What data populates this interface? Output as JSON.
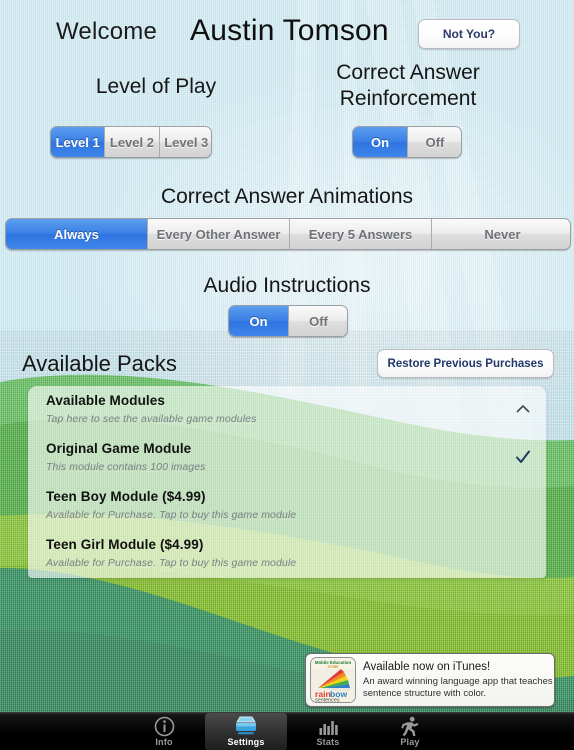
{
  "header": {
    "welcome_label": "Welcome",
    "user_name": "Austin Tomson",
    "not_you_label": "Not You?"
  },
  "sections": {
    "level_of_play": {
      "label": "Level of Play",
      "options": [
        "Level 1",
        "Level 2",
        "Level 3"
      ],
      "selected": "Level 1"
    },
    "correct_answer_reinforcement": {
      "label_line1": "Correct Answer",
      "label_line2": "Reinforcement",
      "options": [
        "On",
        "Off"
      ],
      "selected": "On"
    },
    "correct_answer_animations": {
      "label": "Correct Answer Animations",
      "options": [
        "Always",
        "Every Other Answer",
        "Every 5 Answers",
        "Never"
      ],
      "selected": "Always"
    },
    "audio_instructions": {
      "label": "Audio Instructions",
      "options": [
        "On",
        "Off"
      ],
      "selected": "On"
    }
  },
  "packs": {
    "title": "Available Packs",
    "restore_label": "Restore Previous Purchases",
    "rows": [
      {
        "title": "Available Modules",
        "subtitle": "Tap here to see the available game modules",
        "accessory": "chevron-up-icon"
      },
      {
        "title": "Original Game Module",
        "subtitle": "This module contains 100 images",
        "accessory": "checkmark-icon"
      },
      {
        "title": "Teen Boy Module ($4.99)",
        "subtitle": "Available for Purchase. Tap to buy this game module",
        "accessory": "none"
      },
      {
        "title": "Teen Girl Module ($4.99)",
        "subtitle": "Available for Purchase. Tap to buy this game module",
        "accessory": "none"
      }
    ]
  },
  "ad": {
    "headline": "Available now on iTunes!",
    "body": "An award winning language app that teaches sentence structure with color.",
    "icon_top_label": "Mobile Education",
    "icon_top_sub": "STORE",
    "icon_word1": "rain",
    "icon_word2": "bow",
    "icon_word3": "sentences"
  },
  "tabbar": {
    "tabs": [
      {
        "label": "Info",
        "icon": "info-circle-icon",
        "selected": false
      },
      {
        "label": "Settings",
        "icon": "tray-icon",
        "selected": true
      },
      {
        "label": "Stats",
        "icon": "bar-chart-icon",
        "selected": false
      },
      {
        "label": "Play",
        "icon": "running-man-icon",
        "selected": false
      }
    ]
  },
  "colors": {
    "accent_blue": "#3a7fe4",
    "sky": "#cdeaf2",
    "hill_light_green": "#8ed06a",
    "hill_mid_green": "#5ab44a",
    "hill_dark_green": "#2f8d5a",
    "tabbar_black": "#000000"
  }
}
